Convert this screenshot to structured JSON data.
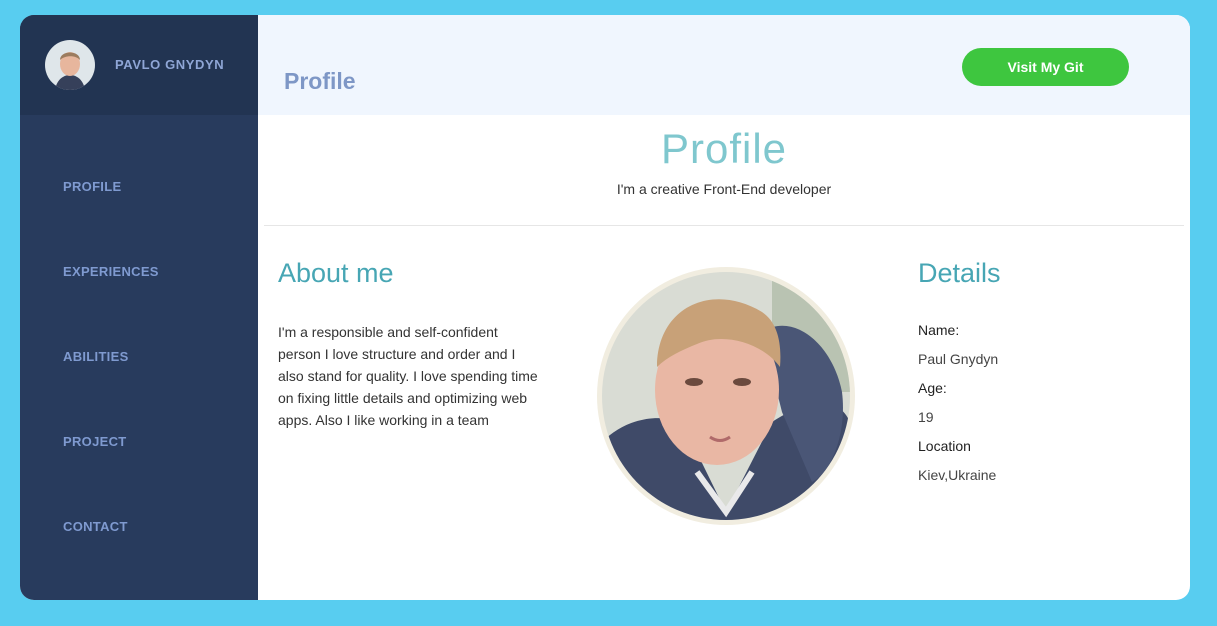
{
  "sidebar": {
    "user_name": "PAVLO GNYDYN",
    "avatar_icon": "user-avatar",
    "items": [
      {
        "label": "PROFILE"
      },
      {
        "label": "EXPERIENCES"
      },
      {
        "label": "ABILITIES"
      },
      {
        "label": "PROJECT"
      },
      {
        "label": "CONTACT"
      }
    ]
  },
  "header": {
    "title": "Profile",
    "git_button_label": "Visit My Git"
  },
  "hero": {
    "title": "Profile",
    "subtitle": "I'm a creative Front-End developer"
  },
  "about": {
    "heading": "About me",
    "text": "I'm a responsible and self-confident person I love structure and order and I also stand for quality. I love spending time on fixing little details and optimizing web apps. Also I like working in a team"
  },
  "details": {
    "heading": "Details",
    "name_label": "Name:",
    "name_value": "Paul Gnydyn",
    "age_label": "Age:",
    "age_value": "19",
    "location_label": "Location",
    "location_value": "Kiev,Ukraine"
  },
  "colors": {
    "background": "#58cdf0",
    "sidebar": "#283b5d",
    "sidebar_header": "#223452",
    "accent_green": "#3ec63f",
    "heading_teal": "#47a6b4",
    "nav_text": "#7f9ad0"
  }
}
